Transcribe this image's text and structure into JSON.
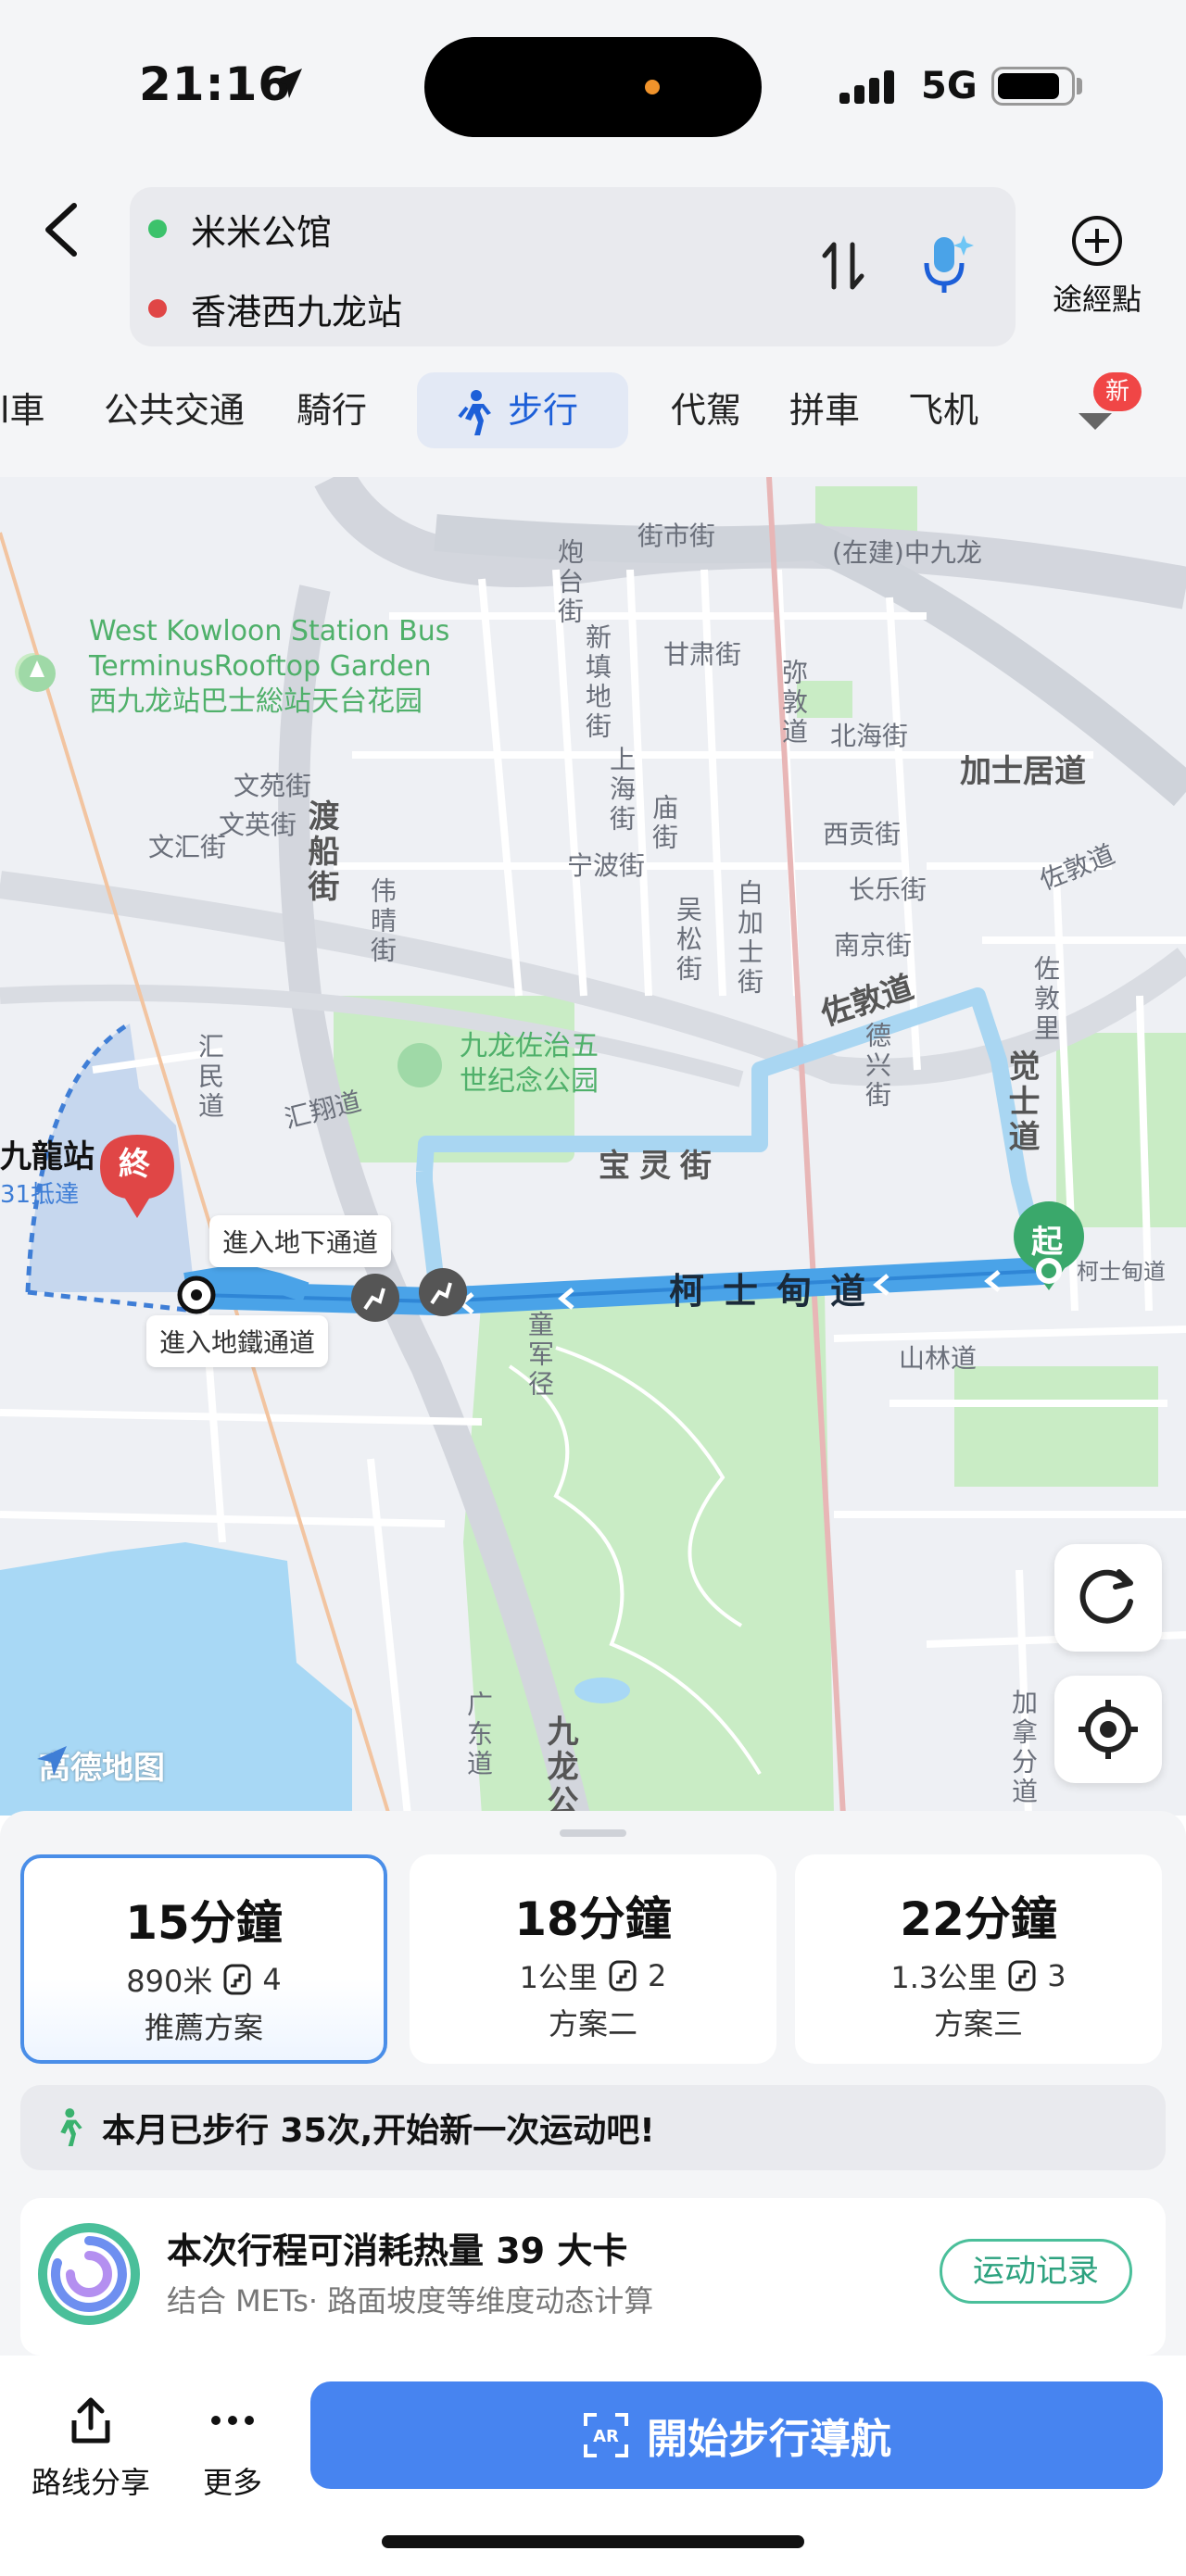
{
  "status": {
    "time": "21:16",
    "network": "5G"
  },
  "route": {
    "origin": "米米公馆",
    "destination": "香港西九龙站",
    "waypoint_label": "途經點"
  },
  "tabs": {
    "cut_left": "l車",
    "items": [
      "公共交通",
      "騎行",
      "步行",
      "代駕",
      "拼車",
      "飞机"
    ],
    "active": "步行",
    "new_badge": "新"
  },
  "map": {
    "labels": {
      "jiesh": "街市街",
      "paotai": "炮台街",
      "xintian": "新填地街",
      "ganshu": "甘肃街",
      "zaijian": "(在建)中九龙",
      "midun": "弥敦道",
      "beihai": "北海街",
      "jiashi": "加士居道",
      "wenyuan": "文苑街",
      "wenying": "文英街",
      "wenhui": "文汇街",
      "duchuan": "渡船街",
      "weiqing": "伟晴街",
      "shanghai": "上海街",
      "miao": "庙街",
      "ningbo": "宁波街",
      "wusong": "吴松街",
      "baijia": "白加士街",
      "xigong": "西贡街",
      "changle": "长乐街",
      "nanjing": "南京街",
      "zuodun_r": "佐敦道",
      "zuodun_ne": "佐敦道",
      "zuodunli": "佐敦里",
      "juesh": "觉士道",
      "dexing": "德兴街",
      "huimin": "汇民道",
      "huixiang": "汇翔道",
      "baoling": "宝灵街",
      "keshidian": "柯士甸道",
      "keshidian_s": "柯士甸道",
      "tongjun": "童军径",
      "shanlin": "山林道",
      "guangdong": "广东道",
      "jiulonggong": "九龙公",
      "jianada": "加拿分道",
      "xiaoshandao": "分道",
      "station_name": "九龍站",
      "arrive_time": "31抵達"
    },
    "park_bus": [
      "West Kowloon Station Bus",
      "TerminusRooftop Garden",
      "西九龙站巴士総站天台花园"
    ],
    "park_zz": [
      "九龙佐治五",
      "世纪念公园"
    ],
    "callout_underpass": "進入地下通道",
    "callout_metro": "進入地鐵通道",
    "end_marker": "終",
    "start_marker": "起",
    "logo": "高德地图"
  },
  "plans": [
    {
      "time": "15分鐘",
      "distance": "890米",
      "stairs": "4",
      "tag": "推薦方案",
      "selected": true
    },
    {
      "time": "18分鐘",
      "distance": "1公里",
      "stairs": "2",
      "tag": "方案二",
      "selected": false
    },
    {
      "time": "22分鐘",
      "distance": "1.3公里",
      "stairs": "3",
      "tag": "方案三",
      "selected": false
    }
  ],
  "stat_text": "本月已步行 35次,开始新一次运动吧!",
  "calorie": {
    "title": "本次行程可消耗热量 39 大卡",
    "subtitle": "结合 METs· 路面坡度等维度动态计算",
    "record_button": "运动记录"
  },
  "bottom": {
    "share_label": "路线分享",
    "more_label": "更多",
    "ar_label": "AR",
    "nav_label": "開始步行導航"
  },
  "colors": {
    "accent": "#4784f0",
    "route": "#4aa3e8",
    "destination": "#e04646",
    "origin_dot": "#3cc26b",
    "park": "#c9ecc5",
    "water": "#a8d8f5"
  }
}
